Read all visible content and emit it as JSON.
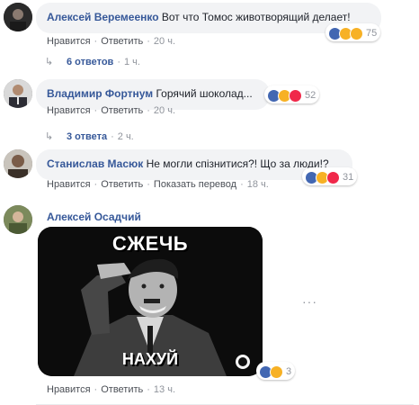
{
  "colors": {
    "author": "#365899",
    "meta": "#90949c",
    "bubble": "#f2f3f5",
    "like": "#4267b2",
    "love": "#f0284a",
    "haha": "#f7b125"
  },
  "comments": [
    {
      "author": "Алексей Веремеенко",
      "text": "Вот что Томос животворящий делает!",
      "actions": {
        "like": "Нравится",
        "reply": "Ответить",
        "time": "20 ч."
      },
      "reactions": {
        "icons": [
          "like-icon",
          "haha-icon",
          "wow-icon"
        ],
        "count": "75"
      },
      "replies": {
        "label": "6 ответов",
        "time": "1 ч."
      }
    },
    {
      "author": "Владимир Фортнум",
      "text": "Горячий шоколад...",
      "actions": {
        "like": "Нравится",
        "reply": "Ответить",
        "time": "20 ч."
      },
      "reactions": {
        "icons": [
          "like-icon",
          "haha-icon",
          "love-icon"
        ],
        "count": "52"
      },
      "replies": {
        "label": "3 ответа",
        "time": "2 ч."
      }
    },
    {
      "author": "Станислав Масюк",
      "text": "Не могли спізнитися?! Що за люди!?",
      "actions": {
        "like": "Нравится",
        "reply": "Ответить",
        "translate": "Показать перевод",
        "time": "18 ч."
      },
      "reactions": {
        "icons": [
          "like-icon",
          "haha-icon",
          "love-icon"
        ],
        "count": "31"
      }
    },
    {
      "author": "Алексей Осадчий",
      "meme": {
        "top_text": "СЖЕЧЬ",
        "bottom_text": "НАХУЙ"
      },
      "actions": {
        "like": "Нравится",
        "reply": "Ответить",
        "time": "13 ч."
      },
      "reactions": {
        "icons": [
          "like-icon",
          "wow-icon"
        ],
        "count": "3"
      }
    }
  ]
}
